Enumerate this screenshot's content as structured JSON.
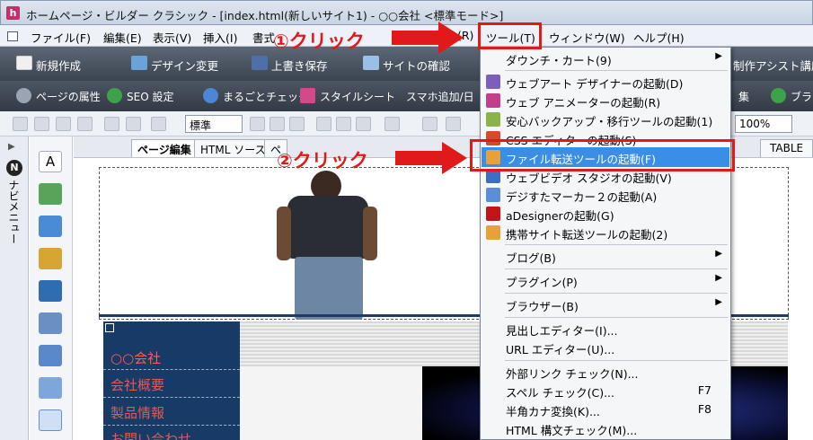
{
  "window": {
    "title": "ホームページ・ビルダー クラシック - [index.html(新しいサイト1) - ○○会社 <標準モード>]",
    "app_icon_letter": "h"
  },
  "menubar": {
    "items": [
      "ファイル(F)",
      "編集(E)",
      "表示(V)",
      "挿入(I)",
      "書式",
      "(R)",
      "ツール(T)",
      "ウィンドウ(W)",
      "ヘルプ(H)"
    ]
  },
  "toolbar1": {
    "buttons": [
      "新規作成",
      "デザイン変更",
      "上書き保存",
      "サイトの確認",
      "制作アシスト講座"
    ]
  },
  "toolbar2": {
    "buttons": [
      "ページの属性",
      "SEO 設定",
      "まるごとチェック",
      "スタイルシート",
      "スマホ追加/日",
      "集",
      "ブラウ"
    ]
  },
  "toolbar3": {
    "style_select": "標準",
    "zoom": "100%",
    "table_btn": "TABLE"
  },
  "navi": {
    "label": "ナビメニュー",
    "badge": "N"
  },
  "tabs": [
    "ページ編集",
    "HTML ソース",
    "ペ"
  ],
  "page": {
    "nav_items": [
      "○○会社",
      "会社概要",
      "製品情報",
      "お問い合わせ"
    ]
  },
  "dropdown": {
    "items": [
      {
        "label": "ダウンチ・カート(9)",
        "submenu": true
      },
      {
        "label": "ウェブアート デザイナーの起動(D)"
      },
      {
        "label": "ウェブ アニメーターの起動(R)"
      },
      {
        "label": "安心バックアップ・移行ツールの起動(1)"
      },
      {
        "label": "CSS エディターの起動(S)"
      },
      {
        "label": "ファイル転送ツールの起動(F)",
        "highlight": true
      },
      {
        "label": "ウェブビデオ スタジオの起動(V)"
      },
      {
        "label": "デジすたマーカー２の起動(A)"
      },
      {
        "label": "aDesignerの起動(G)"
      },
      {
        "label": "携帯サイト転送ツールの起動(2)"
      },
      {
        "label": "ブログ(B)",
        "submenu": true
      },
      {
        "label": "プラグイン(P)",
        "submenu": true
      },
      {
        "label": "ブラウザー(B)",
        "submenu": true
      },
      {
        "label": "見出しエディター(I)..."
      },
      {
        "label": "URL エディター(U)..."
      },
      {
        "label": "外部リンク チェック(N)..."
      },
      {
        "label": "スペル チェック(C)...",
        "shortcut": "F7"
      },
      {
        "label": "半角カナ変換(K)...",
        "shortcut": "F8"
      },
      {
        "label": "HTML 構文チェック(M)..."
      }
    ]
  },
  "annotations": {
    "step1": "①クリック",
    "step2": "②クリック"
  },
  "colors": {
    "highlight": "#3a8ee6",
    "annotation": "#e01a1a",
    "nav_bg": "#183a66",
    "nav_text": "#e05a5a"
  }
}
